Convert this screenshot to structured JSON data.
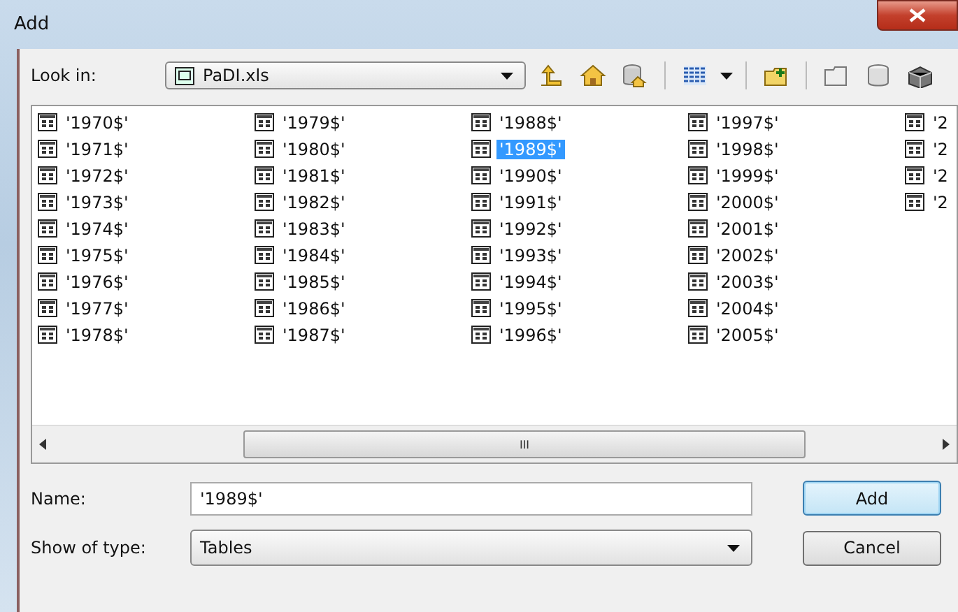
{
  "window": {
    "title": "Add"
  },
  "look_in": {
    "label": "Look in:",
    "value": "PaDI.xls"
  },
  "items": [
    {
      "label": "'1970$'",
      "selected": false
    },
    {
      "label": "'1971$'",
      "selected": false
    },
    {
      "label": "'1972$'",
      "selected": false
    },
    {
      "label": "'1973$'",
      "selected": false
    },
    {
      "label": "'1974$'",
      "selected": false
    },
    {
      "label": "'1975$'",
      "selected": false
    },
    {
      "label": "'1976$'",
      "selected": false
    },
    {
      "label": "'1977$'",
      "selected": false
    },
    {
      "label": "'1978$'",
      "selected": false
    },
    {
      "label": "'1979$'",
      "selected": false
    },
    {
      "label": "'1980$'",
      "selected": false
    },
    {
      "label": "'1981$'",
      "selected": false
    },
    {
      "label": "'1982$'",
      "selected": false
    },
    {
      "label": "'1983$'",
      "selected": false
    },
    {
      "label": "'1984$'",
      "selected": false
    },
    {
      "label": "'1985$'",
      "selected": false
    },
    {
      "label": "'1986$'",
      "selected": false
    },
    {
      "label": "'1987$'",
      "selected": false
    },
    {
      "label": "'1988$'",
      "selected": false
    },
    {
      "label": "'1989$'",
      "selected": true
    },
    {
      "label": "'1990$'",
      "selected": false
    },
    {
      "label": "'1991$'",
      "selected": false
    },
    {
      "label": "'1992$'",
      "selected": false
    },
    {
      "label": "'1993$'",
      "selected": false
    },
    {
      "label": "'1994$'",
      "selected": false
    },
    {
      "label": "'1995$'",
      "selected": false
    },
    {
      "label": "'1996$'",
      "selected": false
    },
    {
      "label": "'1997$'",
      "selected": false
    },
    {
      "label": "'1998$'",
      "selected": false
    },
    {
      "label": "'1999$'",
      "selected": false
    },
    {
      "label": "'2000$'",
      "selected": false
    },
    {
      "label": "'2001$'",
      "selected": false
    },
    {
      "label": "'2002$'",
      "selected": false
    },
    {
      "label": "'2003$'",
      "selected": false
    },
    {
      "label": "'2004$'",
      "selected": false
    },
    {
      "label": "'2005$'",
      "selected": false
    },
    {
      "label": "'2",
      "selected": false
    },
    {
      "label": "'2",
      "selected": false
    },
    {
      "label": "'2",
      "selected": false
    },
    {
      "label": "'2",
      "selected": false
    }
  ],
  "scrollbar": {
    "grip": "III"
  },
  "name": {
    "label": "Name:",
    "value": "'1989$'"
  },
  "type": {
    "label": "Show of type:",
    "value": "Tables"
  },
  "buttons": [
    {
      "label": "Add",
      "default": true
    },
    {
      "label": "Cancel",
      "default": false
    }
  ]
}
